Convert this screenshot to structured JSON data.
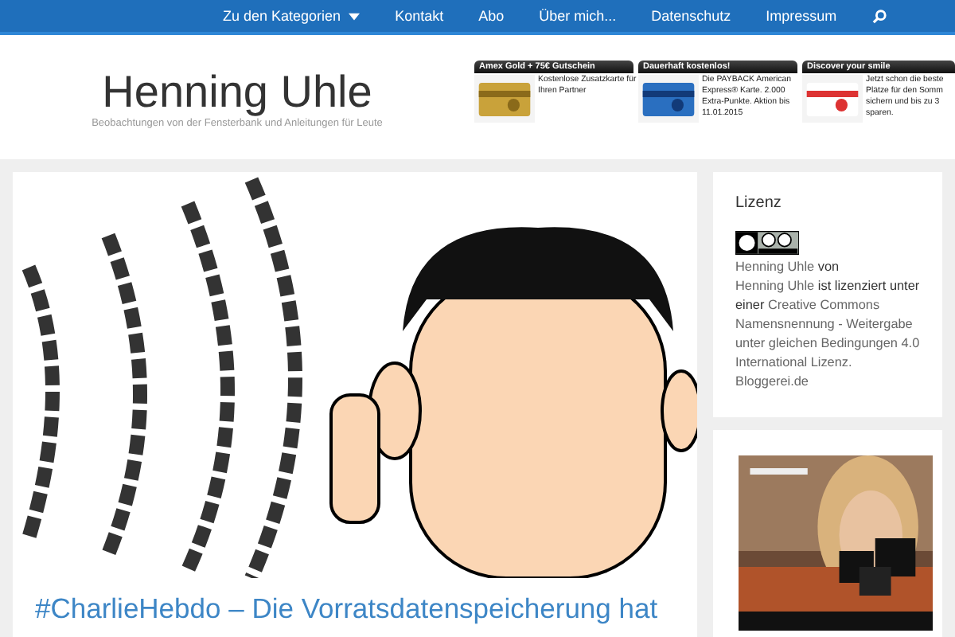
{
  "nav": {
    "items": [
      {
        "label": "Zu den Kategorien",
        "kind": "dropdown"
      },
      {
        "label": "Kontakt",
        "kind": "link"
      },
      {
        "label": "Abo",
        "kind": "link"
      },
      {
        "label": "Über mich...",
        "kind": "link"
      },
      {
        "label": "Datenschutz",
        "kind": "link"
      },
      {
        "label": "Impressum",
        "kind": "link"
      }
    ]
  },
  "header": {
    "title": "Henning Uhle",
    "tagline": "Beobachtungen von der Fensterbank und Anleitungen für Leute",
    "ads": [
      {
        "title": "Amex Gold + 75€ Gutschein",
        "lines": [
          "Kostenlose Zusatzkarte für",
          "Ihren Partner"
        ]
      },
      {
        "title": "Dauerhaft kostenlos!",
        "lines": [
          "Die PAYBACK American",
          "Express® Karte. 2.000",
          "Extra-Punkte. Aktion bis",
          "11.01.2015"
        ]
      },
      {
        "title": "Discover your smile",
        "lines": [
          "Jetzt schon die beste",
          "Plätze für den Somm",
          "sichern und bis zu 3",
          "sparen."
        ]
      }
    ]
  },
  "post": {
    "title": "#CharlieHebdo – Die Vorratsdatenspeicherung hat"
  },
  "sidebar": {
    "widget_title": "Lizenz",
    "license_parts": [
      {
        "kind": "link",
        "text": "Henning Uhle"
      },
      {
        "kind": "text",
        "text": "von"
      },
      {
        "kind": "link",
        "text": "Henning Uhle"
      },
      {
        "kind": "text",
        "text": "ist lizenziert unter einer"
      },
      {
        "kind": "link",
        "text": "Creative Commons"
      },
      {
        "kind": "link",
        "text": "Namensnennung - Weitergabe"
      },
      {
        "kind": "link",
        "text": "unter gleichen Bedingungen 4.0"
      },
      {
        "kind": "link",
        "text": "International Lizenz."
      },
      {
        "kind": "link",
        "text": "Bloggerei.de"
      }
    ]
  }
}
